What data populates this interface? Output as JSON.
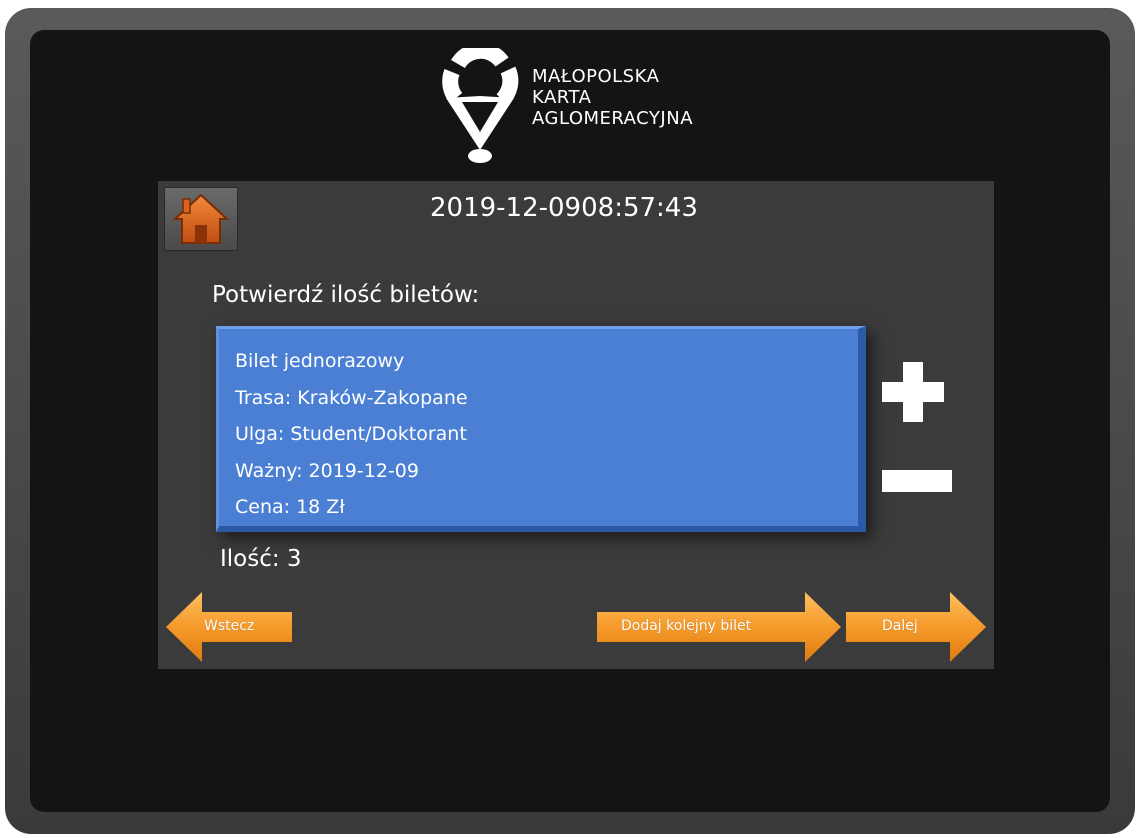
{
  "logo": {
    "name": "mak-logo",
    "lines": [
      "MAŁOPOLSKA",
      "KARTA",
      "AGLOMERACYJNA"
    ]
  },
  "header": {
    "home_icon": "home-icon",
    "date": "2019-12-09",
    "time": "08:57:43"
  },
  "main": {
    "confirm_label": "Potwierdź ilość biletów:",
    "ticket": {
      "type": "Bilet jednorazowy",
      "route": "Trasa: Kraków-Zakopane",
      "discount": "Ulga: Student/Doktorant",
      "valid": "Ważny: 2019-12-09",
      "price": "Cena: 18 Zł"
    },
    "quantity_label": "Ilość: 3",
    "plus_icon": "plus-icon",
    "minus_icon": "minus-icon"
  },
  "footer": {
    "back_label": "Wstecz",
    "add_label": "Dodaj kolejny bilet",
    "next_label": "Dalej"
  },
  "colors": {
    "panel": "#3b3b3b",
    "ticket_box": "#4b7fd4",
    "arrow_orange": "#f39a2b",
    "home_icon": "#e0661c"
  }
}
